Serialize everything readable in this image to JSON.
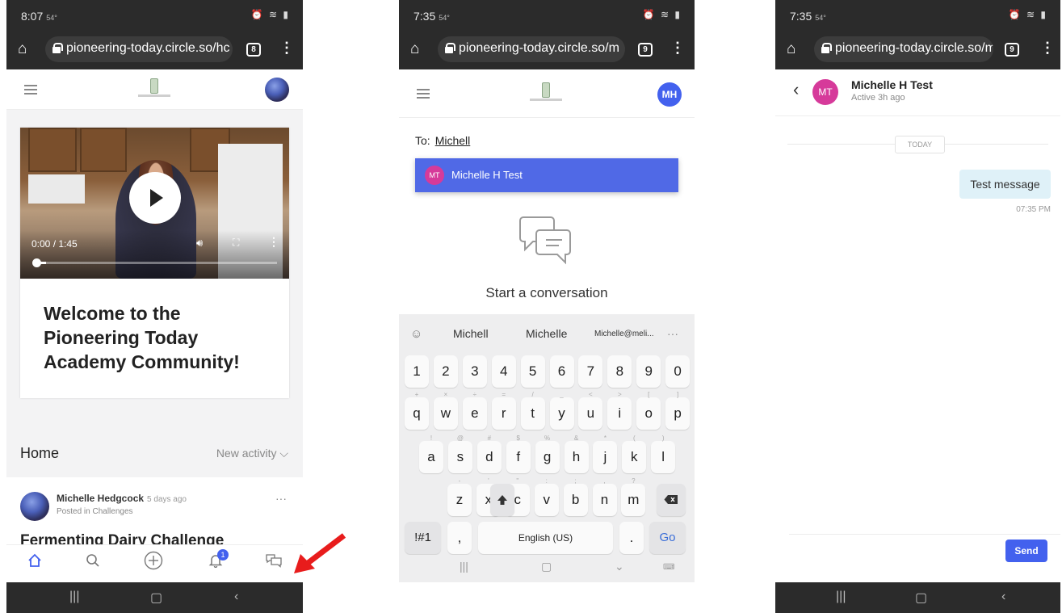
{
  "phone1": {
    "status": {
      "time": "8:07",
      "temp": "54°"
    },
    "url": "pioneering-today.circle.so/hc",
    "tab_count": "8",
    "video": {
      "time": "0:00 / 1:45",
      "progress": 0.04
    },
    "welcome_title": "Welcome to the Pioneering Today Academy Community!",
    "home_label": "Home",
    "new_activity": "New activity ⌵",
    "post": {
      "author": "Michelle Hedgcock",
      "ago": "5 days ago",
      "posted_in": "Posted in Challenges",
      "title": "Fermenting Dairy Challenge",
      "more": "···"
    },
    "notification_count": "1"
  },
  "phone2": {
    "status": {
      "time": "7:35",
      "temp": "54°"
    },
    "url": "pioneering-today.circle.so/m",
    "tab_count": "9",
    "avatar_initials": "MH",
    "to_label": "To:",
    "to_value": "Michell",
    "suggestion": {
      "initials": "MT",
      "name": "Michelle H Test"
    },
    "start_conversation": "Start a conversation",
    "keyboard": {
      "suggestions": [
        "Michell",
        "Michelle",
        "Michelle@meli...",
        "···"
      ],
      "row1": [
        "1",
        "2",
        "3",
        "4",
        "5",
        "6",
        "7",
        "8",
        "9",
        "0"
      ],
      "row2": [
        "q",
        "w",
        "e",
        "r",
        "t",
        "y",
        "u",
        "i",
        "o",
        "p"
      ],
      "row2_sup": [
        "+",
        "×",
        "÷",
        "=",
        "/",
        "_",
        "<",
        ">",
        "[",
        "]"
      ],
      "row3": [
        "a",
        "s",
        "d",
        "f",
        "g",
        "h",
        "j",
        "k",
        "l"
      ],
      "row3_sup": [
        "!",
        "@",
        "#",
        "$",
        "%",
        "&",
        "*",
        "(",
        ")"
      ],
      "row4": [
        "z",
        "x",
        "c",
        "v",
        "b",
        "n",
        "m"
      ],
      "row4_sup": [
        "-",
        "'",
        "\"",
        ":",
        ";",
        ",",
        "?"
      ],
      "sym_label": "!#1",
      "comma": ",",
      "space_label": "English (US)",
      "period": ".",
      "go_label": "Go"
    }
  },
  "phone3": {
    "status": {
      "time": "7:35",
      "temp": "54°"
    },
    "url": "pioneering-today.circle.so/m",
    "tab_count": "9",
    "contact": {
      "initials": "MT",
      "name": "Michelle H Test",
      "status": "Active 3h ago"
    },
    "day_label": "TODAY",
    "message": {
      "text": "Test message",
      "time": "07:35 PM"
    },
    "send_label": "Send"
  },
  "colors": {
    "accent": "#4361ee",
    "pink_avatar": "#d63a9a",
    "bubble": "#dff1f8",
    "arrow": "#e81c1c"
  },
  "icons": {
    "home": "home-icon",
    "search": "search-icon",
    "add": "plus-circle-icon",
    "bell": "bell-icon",
    "chat": "chat-icon"
  }
}
